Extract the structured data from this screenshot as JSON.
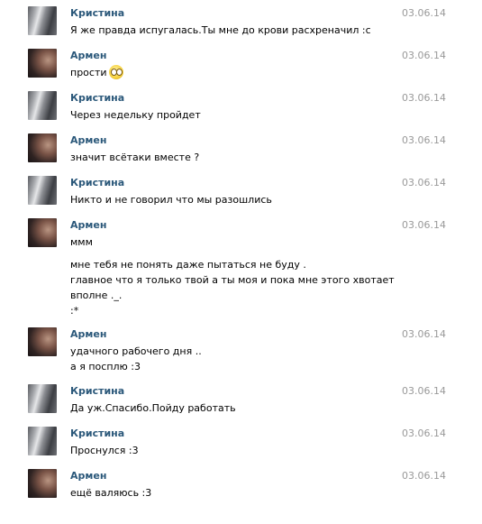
{
  "messages": [
    {
      "author": "Кристина",
      "avatar": "kristina",
      "date": "03.06.14",
      "lines": [
        "Я же правда испугалась.Ты мне до крови расхреначил :с"
      ]
    },
    {
      "author": "Армен",
      "avatar": "armen",
      "date": "03.06.14",
      "lines": [
        "прости"
      ],
      "emoji": "rolling-eyes-emoji-icon"
    },
    {
      "author": "Кристина",
      "avatar": "kristina",
      "date": "03.06.14",
      "lines": [
        "Через недельку пройдет"
      ]
    },
    {
      "author": "Армен",
      "avatar": "armen",
      "date": "03.06.14",
      "lines": [
        "значит всётаки вместе ?"
      ]
    },
    {
      "author": "Кристина",
      "avatar": "kristina",
      "date": "03.06.14",
      "lines": [
        "Никто и не говорил что мы разошлись"
      ]
    },
    {
      "author": "Армен",
      "avatar": "armen",
      "date": "03.06.14",
      "lines": [
        "ммм",
        "",
        "мне тебя не понять даже пытаться не буду .",
        "главное что я только твой а ты моя и пока мне этого хвотает",
        "вполне ._.",
        ":*"
      ]
    },
    {
      "author": "Армен",
      "avatar": "armen",
      "date": "03.06.14",
      "lines": [
        "удачного рабочего дня ..",
        "а я посплю :3"
      ]
    },
    {
      "author": "Кристина",
      "avatar": "kristina",
      "date": "03.06.14",
      "lines": [
        "Да уж.Спасибо.Пойду работать"
      ]
    },
    {
      "author": "Кристина",
      "avatar": "kristina",
      "date": "03.06.14",
      "lines": [
        "Проснулся :3"
      ]
    },
    {
      "author": "Армен",
      "avatar": "armen",
      "date": "03.06.14",
      "lines": [
        "ещё валяюсь :3"
      ]
    }
  ]
}
